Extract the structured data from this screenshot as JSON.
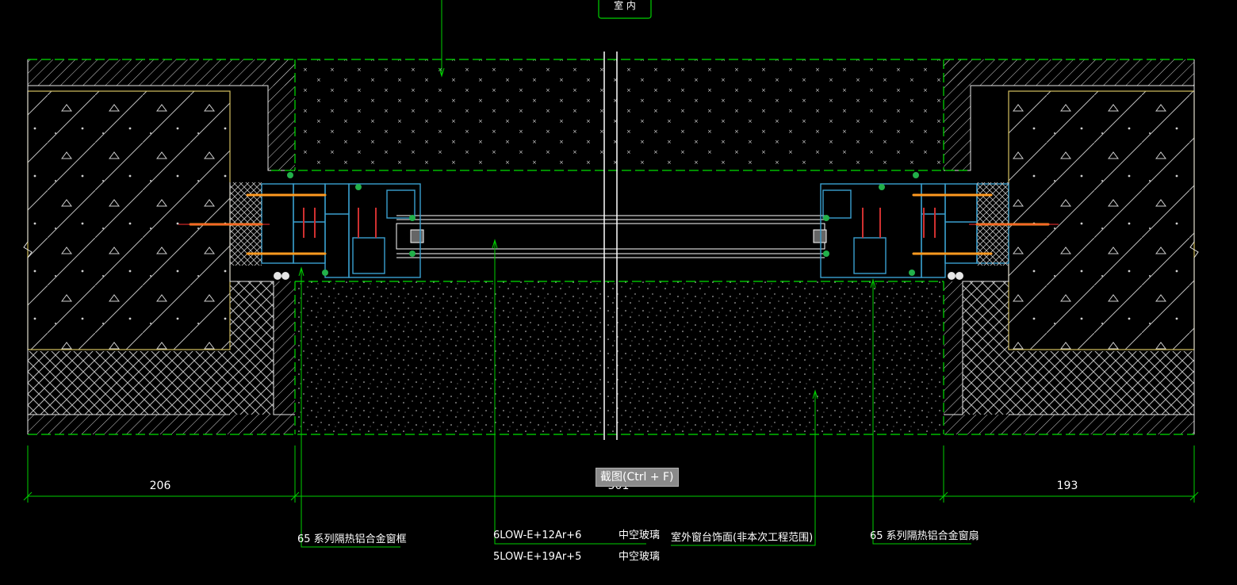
{
  "labels": {
    "room_tag": "室 内",
    "dimensions": [
      "206",
      "501",
      "193"
    ],
    "frame_label": "65  系列隔热铝合金窗框",
    "glass_spec_1": "6LOW-E+12Ar+6",
    "glass_spec_2": "5LOW-E+19Ar+5",
    "glass_type_1": "中空玻璃",
    "glass_type_2": "中空玻璃",
    "sill_note": "室外窗台饰面(非本次工程范围)",
    "sash_label": "65  系列隔热铝合金窗扇"
  },
  "tooltip": {
    "text": "截图(Ctrl + F)"
  },
  "colors": {
    "background": "#000000",
    "dashed_lines": "#00e000",
    "leader_lines": "#00d000",
    "frame_profile": "#3aa0d0",
    "thermal_break": "#d03030",
    "anchor_bolts": "#ff9a20",
    "wall_outline": "#ffffff",
    "plaster_line": "#d4c060",
    "text": "#ffffff"
  }
}
